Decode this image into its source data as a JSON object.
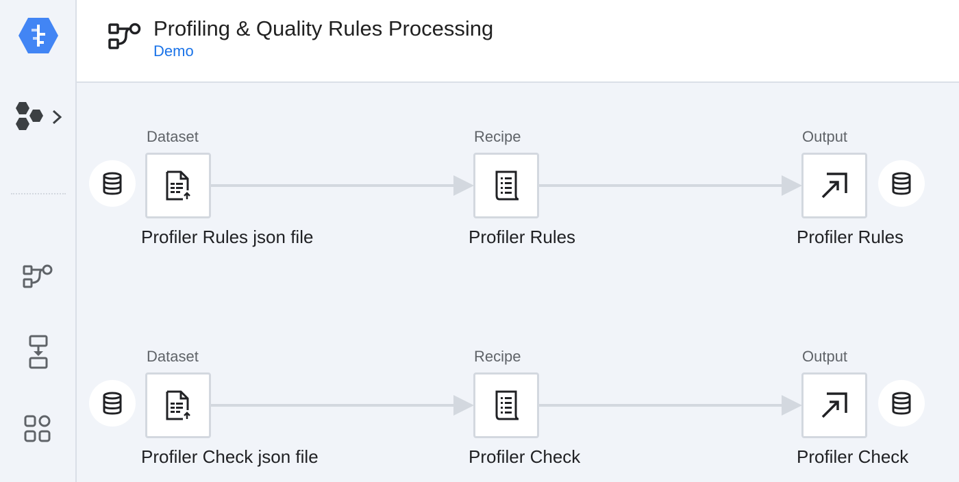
{
  "app": {
    "title": "Profiling & Quality Rules Processing",
    "subtitle": "Demo"
  },
  "rail": {
    "items": [
      {
        "icon": "dataprep-logo-icon"
      },
      {
        "icon": "flows-hexagons-icon"
      },
      {
        "icon": "flow-icon"
      },
      {
        "icon": "import-data-icon"
      },
      {
        "icon": "library-icon"
      }
    ]
  },
  "flows": [
    {
      "dataset": {
        "type_label": "Dataset",
        "name": "Profiler Rules json file",
        "icon": "import-file-icon"
      },
      "recipe": {
        "type_label": "Recipe",
        "name": "Profiler Rules",
        "icon": "recipe-icon"
      },
      "output": {
        "type_label": "Output",
        "name": "Profiler Rules",
        "icon": "output-arrow-icon"
      }
    },
    {
      "dataset": {
        "type_label": "Dataset",
        "name": "Profiler Check json file",
        "icon": "import-file-icon"
      },
      "recipe": {
        "type_label": "Recipe",
        "name": "Profiler Check",
        "icon": "recipe-icon"
      },
      "output": {
        "type_label": "Output",
        "name": "Profiler Check",
        "icon": "output-arrow-icon"
      }
    }
  ],
  "colors": {
    "accent": "#1a73e8",
    "logo_blue": "#4285f4",
    "canvas_bg": "#f1f4f9",
    "edge": "#d3d8df",
    "icon": "#202124"
  }
}
